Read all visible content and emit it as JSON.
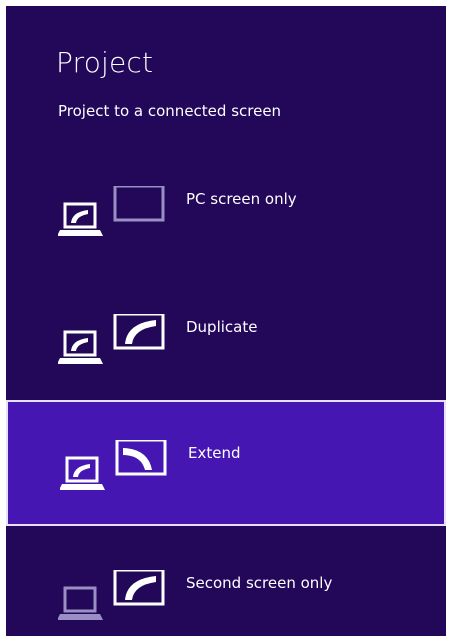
{
  "panel": {
    "title": "Project",
    "subtitle": "Project to a connected screen"
  },
  "options": [
    {
      "label": "PC screen only",
      "icon": "pc-screen-only-icon",
      "selected": false
    },
    {
      "label": "Duplicate",
      "icon": "duplicate-icon",
      "selected": false
    },
    {
      "label": "Extend",
      "icon": "extend-icon",
      "selected": true
    },
    {
      "label": "Second screen only",
      "icon": "second-screen-only-icon",
      "selected": false
    }
  ],
  "colors": {
    "background": "#23085a",
    "selected_background": "#4616b2",
    "selected_border": "#e8e0ff",
    "dim_icon": "#9a8fc4",
    "text": "#ffffff"
  }
}
